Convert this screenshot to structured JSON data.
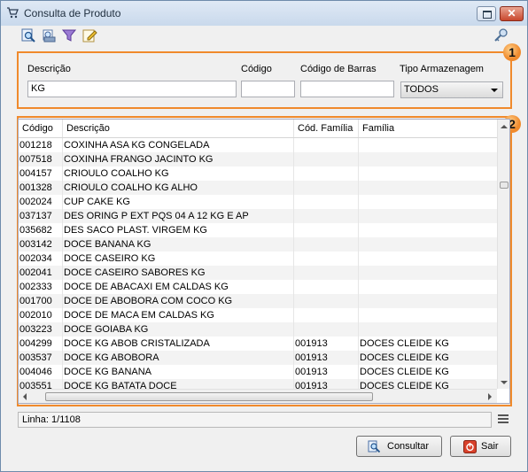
{
  "window": {
    "title": "Consulta de Produto"
  },
  "icons": {
    "app": "cart-icon",
    "toolbar": [
      "search-document-icon",
      "print-preview-icon",
      "filter-icon",
      "edit-icon"
    ],
    "key": "key-icon"
  },
  "panel1": {
    "badge": "1",
    "descricao": {
      "label": "Descrição",
      "value": "KG"
    },
    "codigo": {
      "label": "Código",
      "value": ""
    },
    "codigo_barras": {
      "label": "Código de Barras",
      "value": ""
    },
    "tipo_armazenagem": {
      "label": "Tipo Armazenagem",
      "selected": "TODOS"
    }
  },
  "panel2": {
    "badge": "2"
  },
  "grid": {
    "columns": [
      "Código",
      "Descrição",
      "Cód. Família",
      "Família"
    ],
    "rows": [
      [
        "001218",
        "COXINHA ASA KG CONGELADA",
        "",
        ""
      ],
      [
        "007518",
        "COXINHA FRANGO JACINTO KG",
        "",
        ""
      ],
      [
        "004157",
        "CRIOULO COALHO KG",
        "",
        ""
      ],
      [
        "001328",
        "CRIOULO COALHO KG ALHO",
        "",
        ""
      ],
      [
        "002024",
        "CUP CAKE KG",
        "",
        ""
      ],
      [
        "037137",
        "DES ORING P EXT PQS 04 A 12 KG E AP",
        "",
        ""
      ],
      [
        "035682",
        "DES SACO PLAST. VIRGEM KG",
        "",
        ""
      ],
      [
        "003142",
        "DOCE BANANA KG",
        "",
        ""
      ],
      [
        "002034",
        "DOCE CASEIRO KG",
        "",
        ""
      ],
      [
        "002041",
        "DOCE CASEIRO SABORES KG",
        "",
        ""
      ],
      [
        "002333",
        "DOCE DE ABACAXI EM CALDAS KG",
        "",
        ""
      ],
      [
        "001700",
        "DOCE DE ABOBORA COM COCO KG",
        "",
        ""
      ],
      [
        "002010",
        "DOCE DE MACA EM CALDAS KG",
        "",
        ""
      ],
      [
        "003223",
        "DOCE GOIABA KG",
        "",
        ""
      ],
      [
        "004299",
        "DOCE KG ABOB CRISTALIZADA",
        "001913",
        "DOCES CLEIDE KG"
      ],
      [
        "003537",
        "DOCE KG ABOBORA",
        "001913",
        "DOCES CLEIDE KG"
      ],
      [
        "004046",
        "DOCE KG BANANA",
        "001913",
        "DOCES CLEIDE KG"
      ],
      [
        "003551",
        "DOCE KG BATATA DOCE",
        "001913",
        "DOCES CLEIDE KG"
      ]
    ]
  },
  "status": {
    "linha": "Linha: 1/1108"
  },
  "buttons": {
    "consultar": "Consultar",
    "sair": "Sair"
  },
  "colors": {
    "highlight": "#f08a2c"
  }
}
